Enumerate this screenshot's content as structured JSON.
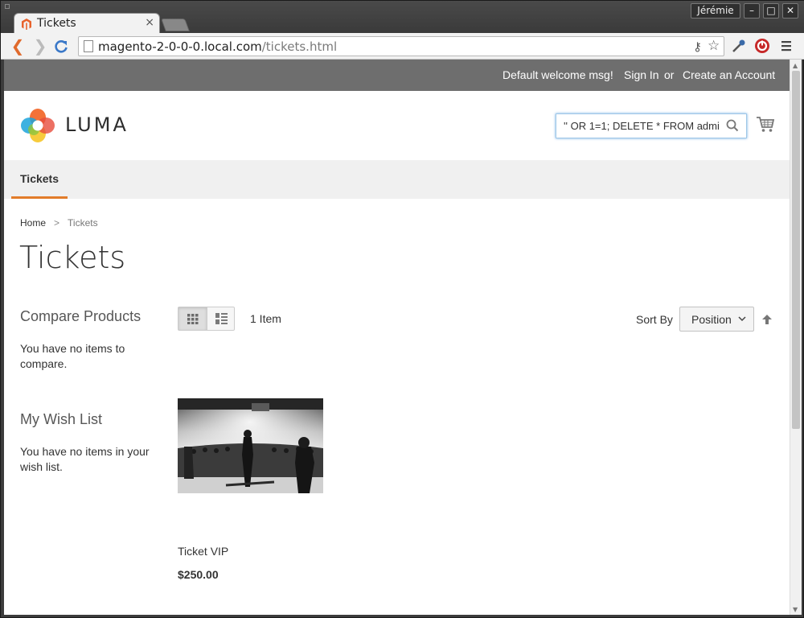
{
  "browser": {
    "tab_title": "Tickets",
    "tab_close": "×",
    "user_name": "Jérémie",
    "url_host": "magento-2-0-0-0.local.com",
    "url_path": "/tickets.html",
    "icons": [
      "back-icon",
      "forward-icon",
      "reload-icon",
      "page-icon",
      "key-icon",
      "star-icon",
      "eyedropper-icon",
      "stop-icon",
      "menu-icon"
    ]
  },
  "header": {
    "welcome": "Default welcome msg!",
    "sign_in": "Sign In",
    "or": "or",
    "create_account": "Create an Account",
    "logo_text": "LUMA",
    "search_value": "'' OR 1=1; DELETE * FROM admi"
  },
  "nav": {
    "items": [
      {
        "label": "Tickets"
      }
    ]
  },
  "breadcrumb": {
    "home": "Home",
    "separator": ">",
    "current": "Tickets"
  },
  "page": {
    "title": "Tickets"
  },
  "sidebar": {
    "compare_title": "Compare Products",
    "compare_text": "You have no items to compare.",
    "wishlist_title": "My Wish List",
    "wishlist_text": "You have no items in your wish list."
  },
  "toolbar": {
    "amount": "1 Item",
    "sort_label": "Sort By",
    "sort_value": "Position"
  },
  "products": [
    {
      "name": "Ticket VIP",
      "price": "$250.00"
    }
  ],
  "colors": {
    "header_bar": "#6e6e6e",
    "nav_active": "#e27c2a",
    "nav_bg": "#f0f0f0"
  }
}
